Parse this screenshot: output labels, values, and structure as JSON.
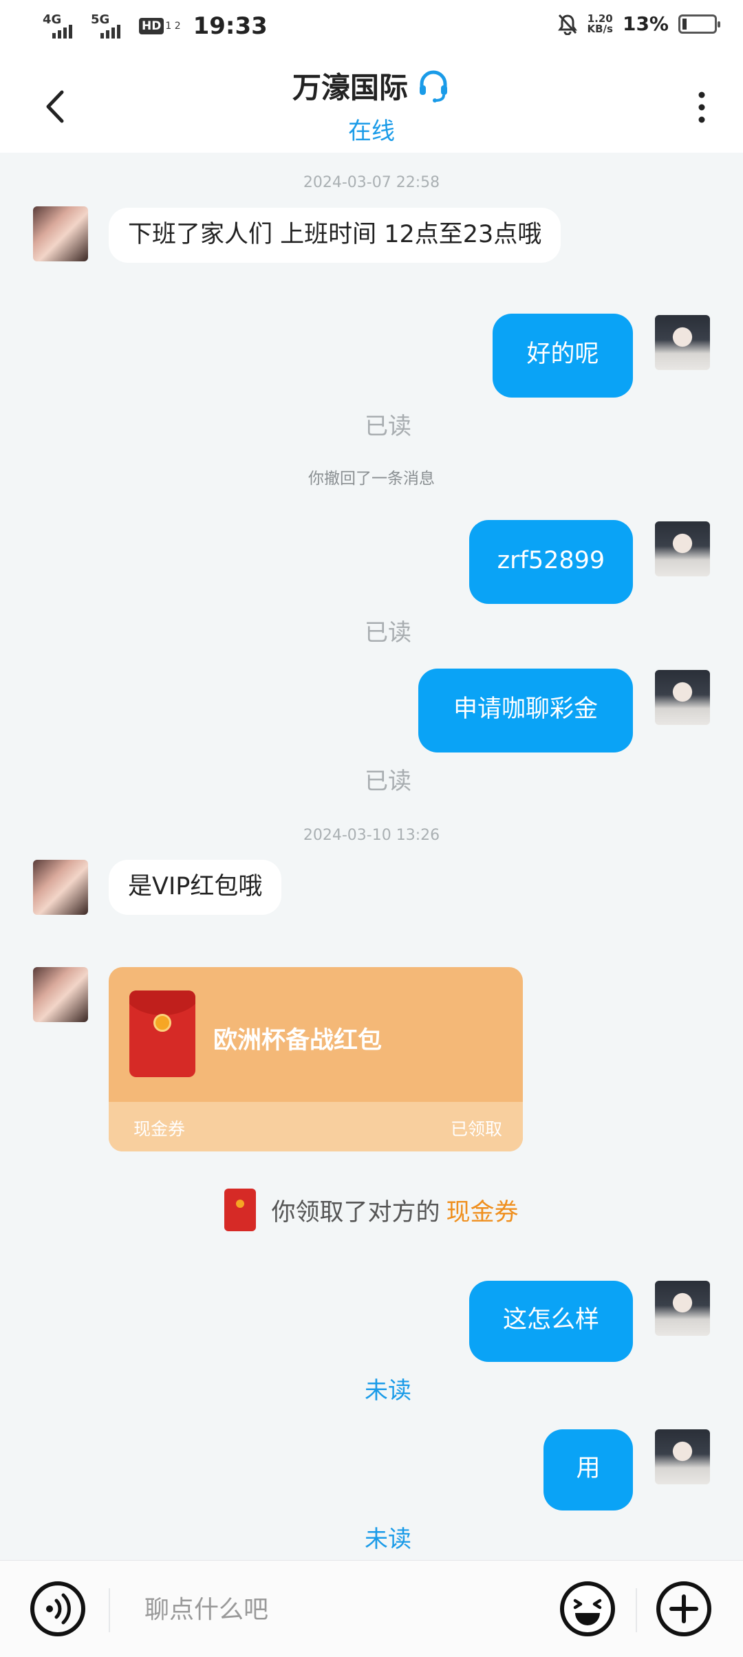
{
  "status_bar": {
    "net1": "4G",
    "net2": "5G",
    "hd": "HD",
    "hd_sub": "1 2",
    "time": "19:33",
    "speed_value": "1.20",
    "speed_unit": "KB/s",
    "battery": "13%"
  },
  "header": {
    "title": "万濠国际",
    "status": "在线"
  },
  "chat": {
    "ts1": "2024-03-07 22:58",
    "msg1": "下班了家人们 上班时间 12点至23点哦",
    "msg2": "好的呢",
    "read2": "已读",
    "sys1": "你撤回了一条消息",
    "msg3": "zrf52899",
    "read3": "已读",
    "msg4": "申请咖聊彩金",
    "read4": "已读",
    "ts2": "2024-03-10 13:26",
    "msg5": "是VIP红包哦",
    "red_packet": {
      "name": "欧洲杯备战红包",
      "type": "现金券",
      "status": "已领取"
    },
    "received_text": "你领取了对方的",
    "received_link": "现金券",
    "msg6": "这怎么样",
    "read6": "未读",
    "msg7": "用",
    "read7": "未读"
  },
  "input": {
    "placeholder": "聊点什么吧"
  },
  "colors": {
    "accent": "#0aa3f6",
    "online": "#1a9be8",
    "red_packet_bg": "#f4b877",
    "received_link": "#ef8f1e"
  }
}
